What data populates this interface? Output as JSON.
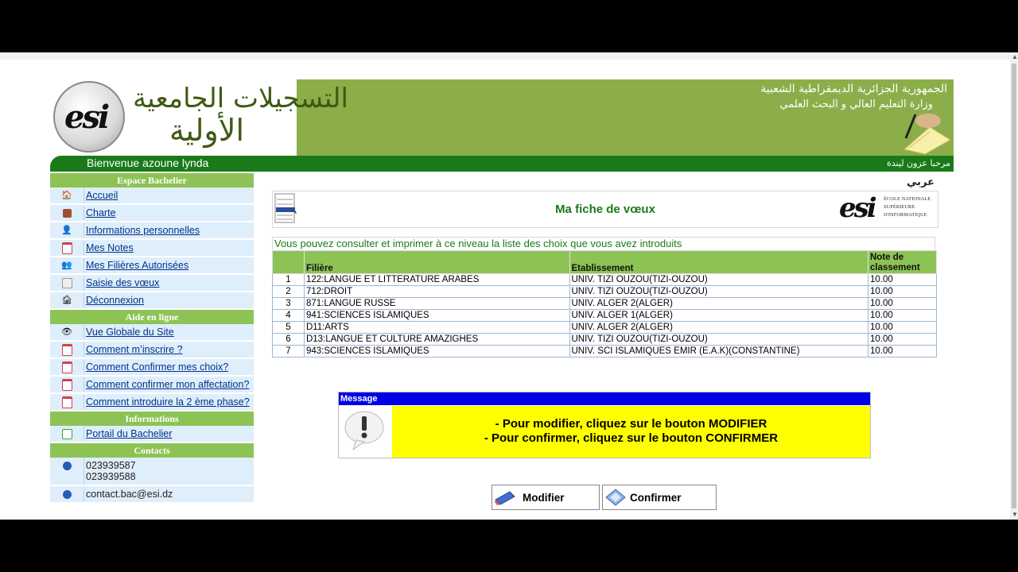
{
  "banner": {
    "logo_text": "esi",
    "arabic_title_line1": "التسجيلات الجامعية",
    "arabic_title_line2": "الأولية",
    "republic_line": "الجمهورية الجزائرية الديمقراطية الشعبية",
    "ministry_line": "وزارة التعليم العالي و البحث العلمي"
  },
  "welcome": {
    "fr": "Bienvenue azoune lynda",
    "ar": "مرحبا عزون ليندة"
  },
  "sidebar": {
    "espace_title": "Espace Bachelier",
    "espace_items": [
      {
        "label": "Accueil",
        "icon": "home-icon"
      },
      {
        "label": "Charte",
        "icon": "briefcase-icon"
      },
      {
        "label": "Informations personnelles",
        "icon": "user-icon"
      },
      {
        "label": "Mes Notes",
        "icon": "calendar-icon"
      },
      {
        "label": "Mes Filières Autorisées",
        "icon": "users-icon"
      },
      {
        "label": "Saisie des vœux",
        "icon": "notepad-icon"
      },
      {
        "label": "Déconnexion",
        "icon": "house-exit-icon"
      }
    ],
    "aide_title": "Aide en ligne",
    "aide_items": [
      {
        "label": "Vue Globale du Site",
        "icon": "eye-icon"
      },
      {
        "label": "Comment m’inscrire ?",
        "icon": "calendar-icon"
      },
      {
        "label": "Comment Confirmer mes choix?",
        "icon": "calendar-icon"
      },
      {
        "label": "Comment confirmer mon affectation?",
        "icon": "calendar-icon"
      },
      {
        "label": "Comment introduire la 2 ème phase?",
        "icon": "calendar-icon"
      }
    ],
    "info_title": "Informations",
    "info_items": [
      {
        "label": "Portail du Bachelier",
        "icon": "portal-icon"
      }
    ],
    "contacts_title": "Contacts",
    "contacts": {
      "phone1": "023939587",
      "phone2": "023939588",
      "email": "contact.bac@esi.dz"
    }
  },
  "main": {
    "lang_link": "عربي",
    "title": "Ma fiche de vœux",
    "esi_logo_big": "esi",
    "esi_logo_lines": [
      "ÉCOLE NATIONALE",
      "SUPÉRIEURE",
      "D'INFORMATIQUE"
    ],
    "info_text": "Vous pouvez consulter et imprimer à ce niveau la liste des choix que vous avez introduits",
    "table": {
      "headers": [
        "",
        "Filière",
        "Etablissement",
        "Note de classement"
      ],
      "rows": [
        [
          "1",
          "122:LANGUE ET LITTERATURE ARABES",
          "UNIV. TIZI OUZOU(TIZI-OUZOU)",
          "10.00"
        ],
        [
          "2",
          "712:DROIT",
          "UNIV. TIZI OUZOU(TIZI-OUZOU)",
          "10.00"
        ],
        [
          "3",
          "871:LANGUE RUSSE",
          "UNIV. ALGER 2(ALGER)",
          "10.00"
        ],
        [
          "4",
          "941:SCIENCES ISLAMIQUES",
          "UNIV. ALGER 1(ALGER)",
          "10.00"
        ],
        [
          "5",
          "D11:ARTS",
          "UNIV. ALGER 2(ALGER)",
          "10.00"
        ],
        [
          "6",
          "D13:LANGUE ET CULTURE AMAZIGHES",
          "UNIV. TIZI OUZOU(TIZI-OUZOU)",
          "10.00"
        ],
        [
          "7",
          "943:SCIENCES ISLAMIQUES",
          "UNIV. SCI ISLAMIQUES EMIR (E.A.K)(CONSTANTINE)",
          "10.00"
        ]
      ]
    },
    "message": {
      "header": "Message",
      "line1": "- Pour modifier, cliquez sur le bouton MODIFIER",
      "line2": "- Pour confirmer, cliquez sur le bouton CONFIRMER"
    },
    "buttons": {
      "modifier": "Modifier",
      "confirmer": "Confirmer"
    }
  },
  "colors": {
    "banner_green": "#8bae4a",
    "welcome_green": "#1a7a1a",
    "section_green": "#8dc354",
    "message_blue": "#0000e6",
    "message_yellow": "#ffff00"
  }
}
